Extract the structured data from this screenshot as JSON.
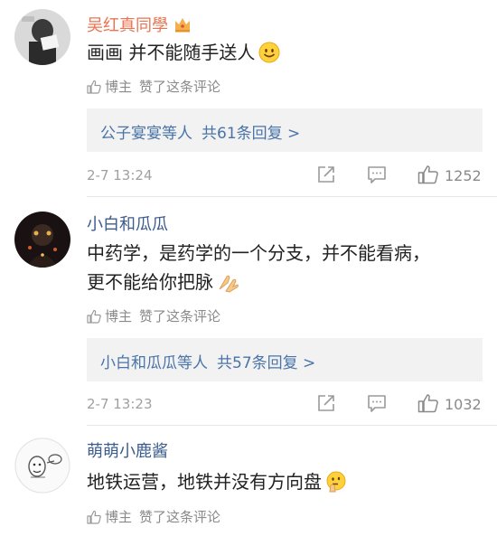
{
  "comments": [
    {
      "username": "吴红真同學",
      "text_lines": [
        "画画 并不能随手送人"
      ],
      "emoji": "smile-emoji",
      "liked_by": {
        "author": "博主",
        "action": "赞了这条评论"
      },
      "replies": {
        "who": "公子宴宴等人",
        "count": "共61条回复 >"
      },
      "time": "2-7 13:24",
      "likes": "1252"
    },
    {
      "username": "小白和瓜瓜",
      "text_lines": [
        "中药学，是药学的一个分支，并不能看病，",
        "更不能给你把脉"
      ],
      "emoji": "pray-hands-emoji",
      "liked_by": {
        "author": "博主",
        "action": "赞了这条评论"
      },
      "replies": {
        "who": "小白和瓜瓜等人",
        "count": "共57条回复 >"
      },
      "time": "2-7 13:23",
      "likes": "1032"
    },
    {
      "username": "萌萌小鹿酱",
      "text_lines": [
        "地铁运营，地铁并没有方向盘"
      ],
      "emoji": "thinking-emoji",
      "liked_by": {
        "author": "博主",
        "action": "赞了这条评论"
      }
    }
  ],
  "colors": {
    "username_vip": "#eb7350",
    "username": "#3b5c8c",
    "link": "#4a74a8",
    "muted": "#8a8a8a",
    "reply_bg": "#f2f2f2"
  },
  "icons": [
    "crown-icon",
    "thumbs-up-icon",
    "share-icon",
    "reply-icon",
    "like-icon"
  ]
}
